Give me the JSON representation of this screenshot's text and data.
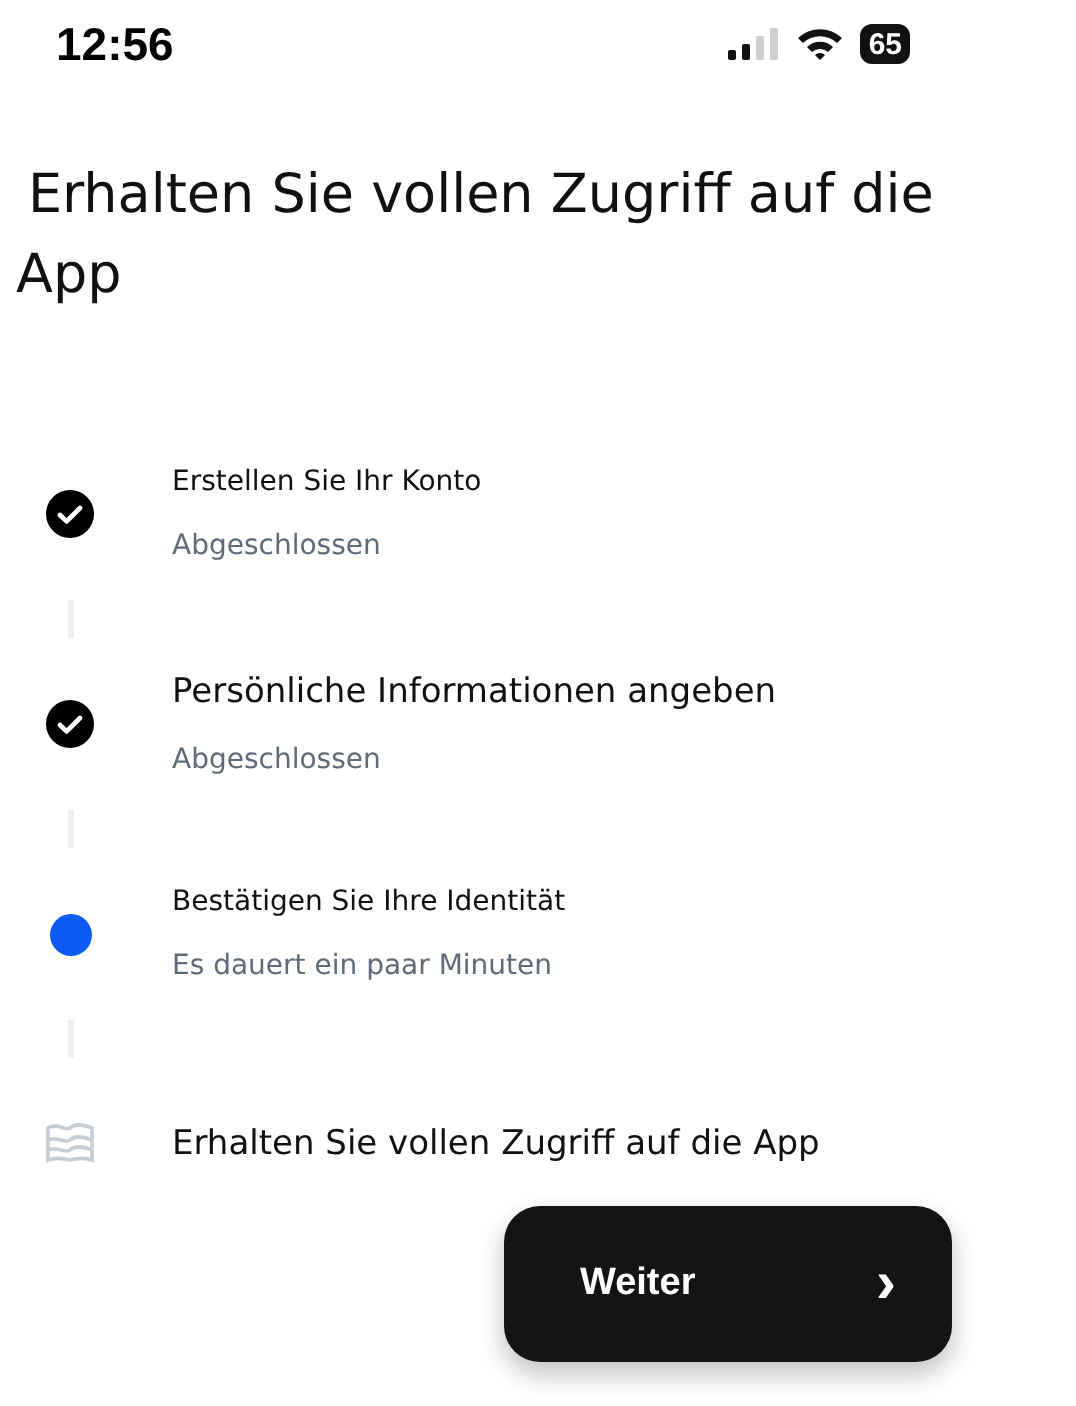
{
  "status_bar": {
    "time": "12:56",
    "battery": "65"
  },
  "title": "Erhalten Sie vollen Zugriff auf die App",
  "steps": [
    {
      "kind": "done",
      "title": "Erstellen Sie Ihr Konto",
      "subtitle": "Abgeschlossen"
    },
    {
      "kind": "done",
      "title": "Persönliche Informationen angeben",
      "subtitle": "Abgeschlossen"
    },
    {
      "kind": "current",
      "title": "Bestätigen Sie Ihre Identität",
      "subtitle": "Es dauert ein paar Minuten"
    },
    {
      "kind": "pending",
      "title": "Erhalten Sie vollen Zugriff auf die App"
    }
  ],
  "continue_button": {
    "label": "Weiter",
    "icon": "›"
  }
}
